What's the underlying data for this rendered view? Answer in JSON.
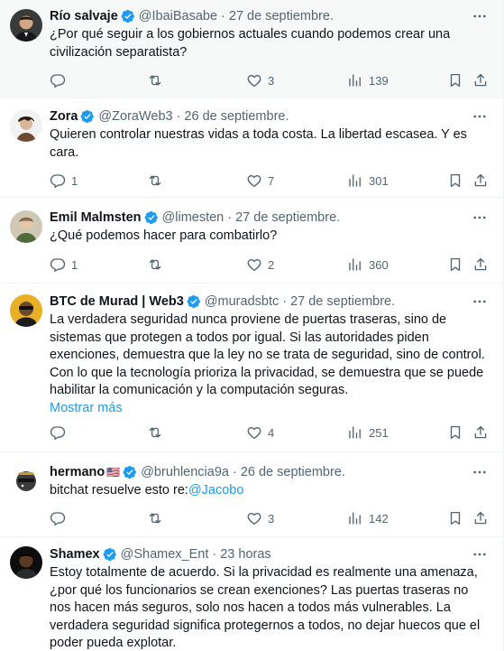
{
  "tweets": [
    {
      "name": "Río salvaje",
      "handle": "@IbaiBasabe",
      "separator": "·",
      "date": "27 de septiembre.",
      "text": "¿Por qué seguir a los gobiernos actuales cuando podemos crear una civilización separatista?",
      "replies": "",
      "retweets": "",
      "likes": "3",
      "views": "139"
    },
    {
      "name": "Zora",
      "handle": "@ZoraWeb3",
      "separator": "·",
      "date": "26 de septiembre.",
      "text": "Quieren controlar nuestras vidas a toda costa. La libertad escasea. Y es cara.",
      "replies": "1",
      "retweets": "",
      "likes": "7",
      "views": "301"
    },
    {
      "name": "Emil Malmsten",
      "handle": "@limesten",
      "separator": "·",
      "date": "27 de septiembre.",
      "text": "¿Qué podemos hacer para combatirlo?",
      "replies": "1",
      "retweets": "",
      "likes": "2",
      "views": "360"
    },
    {
      "name": "BTC de Murad | Web3",
      "handle": "@muradsbtc",
      "separator": "·",
      "date": "27 de septiembre.",
      "text": "La verdadera seguridad nunca proviene de puertas traseras, sino de sistemas que protegen a todos por igual. Si las autoridades piden exenciones, demuestra que la ley no se trata de seguridad, sino de control. Con lo que la tecnología prioriza la privacidad, se demuestra que se puede habilitar la comunicación y la computación seguras.",
      "show_more": "Mostrar más",
      "replies": "",
      "retweets": "",
      "likes": "4",
      "views": "251"
    },
    {
      "name": "hermano",
      "flag": "🇺🇸",
      "handle": "@bruhlencia9a",
      "separator": "·",
      "date": "26 de septiembre.",
      "text_prefix": "bitchat resuelve esto re:",
      "mention": "@Jacobo",
      "replies": "",
      "retweets": "",
      "likes": "3",
      "views": "142"
    },
    {
      "name": "Shamex",
      "handle": "@Shamex_Ent",
      "separator": "·",
      "date": "23 horas",
      "text": "Estoy totalmente de acuerdo. Si la privacidad es realmente una amenaza, ¿por qué los funcionarios se crean exenciones? Las puertas traseras no nos hacen más seguros, solo nos hacen a todos más vulnerables. La verdadera seguridad significa protegernos a todos, no dejar huecos que el poder pueda explotar."
    }
  ],
  "icons": {
    "verified": "verified-badge-icon",
    "more": "more-icon",
    "reply": "reply-icon",
    "retweet": "retweet-icon",
    "like": "heart-icon",
    "views": "views-icon",
    "bookmark": "bookmark-icon",
    "share": "share-icon"
  },
  "colors": {
    "verified": "#1d9bf0",
    "link": "#1d9bf0",
    "secondary_text": "#536471",
    "highlight_bg": "#f7f9f9"
  }
}
